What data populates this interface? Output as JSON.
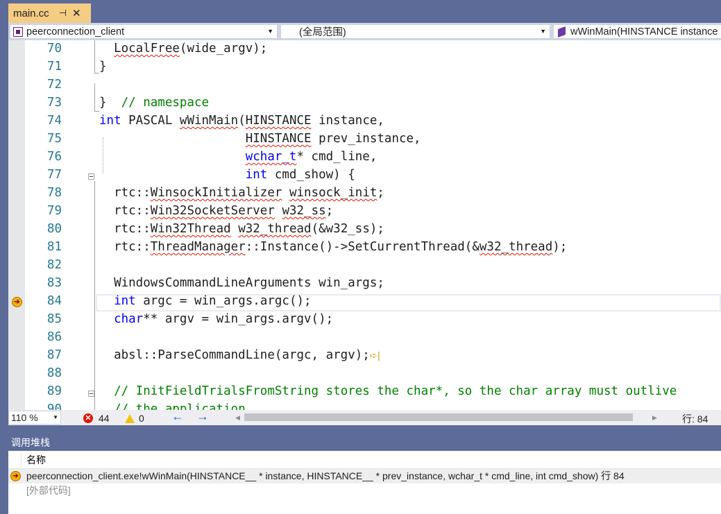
{
  "tab": {
    "title": "main.cc",
    "pin_glyph": "⊣",
    "close_glyph": "✕"
  },
  "navbar": {
    "project": "peerconnection_client",
    "scope": "(全局范围)",
    "function": "wWinMain(HINSTANCE instance"
  },
  "editor": {
    "current_line": 84,
    "lines": [
      {
        "n": "70"
      },
      {
        "n": "71"
      },
      {
        "n": "72"
      },
      {
        "n": "73"
      },
      {
        "n": "74"
      },
      {
        "n": "75"
      },
      {
        "n": "76"
      },
      {
        "n": "77"
      },
      {
        "n": "78"
      },
      {
        "n": "79"
      },
      {
        "n": "80"
      },
      {
        "n": "81"
      },
      {
        "n": "82"
      },
      {
        "n": "83"
      },
      {
        "n": "84"
      },
      {
        "n": "85"
      },
      {
        "n": "86"
      },
      {
        "n": "87"
      },
      {
        "n": "88"
      },
      {
        "n": "89"
      },
      {
        "n": "90"
      }
    ]
  },
  "statusbar": {
    "zoom": "110 %",
    "errors": "44",
    "warnings": "0",
    "line_label": "行: 84",
    "colors": {
      "error": "#e51400",
      "warning": "#f3c10b"
    }
  },
  "callstack": {
    "title": "调用堆栈",
    "column_name": "名称",
    "rows": [
      {
        "text": "peerconnection_client.exe!wWinMain(HINSTANCE__ * instance, HINSTANCE__ * prev_instance, wchar_t * cmd_line, int cmd_show) 行 84",
        "current": true
      },
      {
        "text": "[外部代码]",
        "current": false
      }
    ]
  },
  "colors": {
    "frame": "#5d6b99",
    "tab_active": "#f5cc84",
    "keyword": "#0000ff",
    "comment": "#008000",
    "line_number": "#237893",
    "current_arrow": "#f6b20a"
  },
  "icons": [
    "pin-icon",
    "close-icon",
    "project-icon",
    "cube-icon",
    "chevron-down-icon",
    "current-statement-arrow-icon",
    "error-icon",
    "warning-icon",
    "back-arrow-icon",
    "forward-arrow-icon"
  ]
}
